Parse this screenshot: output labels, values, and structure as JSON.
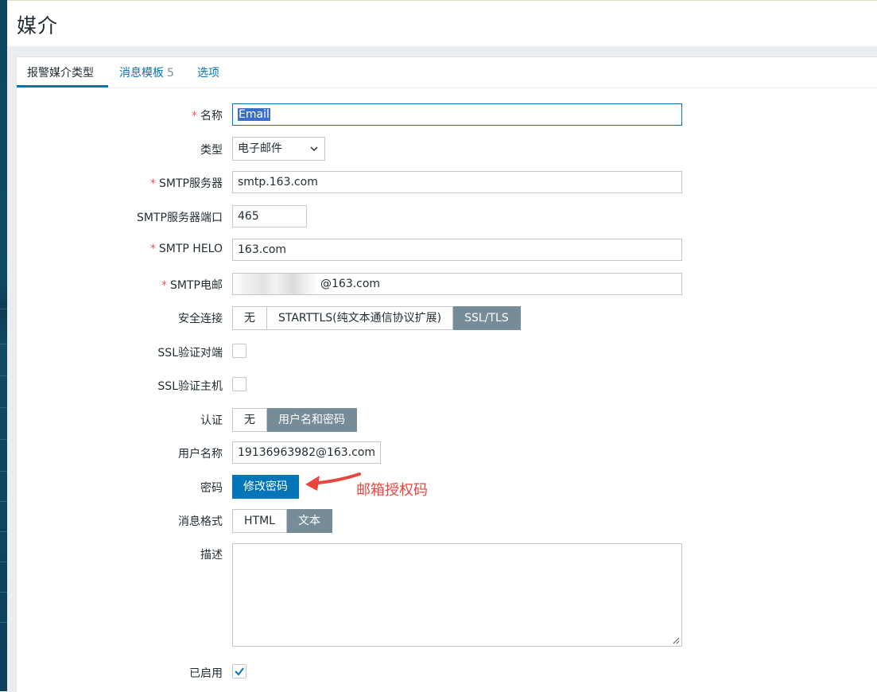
{
  "page": {
    "title": "媒介"
  },
  "tabs": [
    {
      "label": "报警媒介类型",
      "active": true
    },
    {
      "label": "消息模板",
      "count": "5"
    },
    {
      "label": "选项"
    }
  ],
  "form": {
    "name": {
      "label": "名称",
      "value": "Email",
      "required": true
    },
    "type": {
      "label": "类型",
      "value": "电子邮件"
    },
    "smtp_server": {
      "label": "SMTP服务器",
      "value": "smtp.163.com",
      "required": true
    },
    "smtp_port": {
      "label": "SMTP服务器端口",
      "value": "465"
    },
    "smtp_helo": {
      "label": "SMTP HELO",
      "value": "163.com",
      "required": true
    },
    "smtp_email": {
      "label": "SMTP电邮",
      "value": "@163.com",
      "required": true
    },
    "security": {
      "label": "安全连接",
      "options": [
        "无",
        "STARTTLS(纯文本通信协议扩展)",
        "SSL/TLS"
      ],
      "selected": "SSL/TLS"
    },
    "ssl_verify_peer": {
      "label": "SSL验证对端",
      "checked": false
    },
    "ssl_verify_host": {
      "label": "SSL验证主机",
      "checked": false
    },
    "auth": {
      "label": "认证",
      "options": [
        "无",
        "用户名和密码"
      ],
      "selected": "用户名和密码"
    },
    "username": {
      "label": "用户名称",
      "value": "19136963982@163.com"
    },
    "password": {
      "label": "密码",
      "button": "修改密码"
    },
    "message_format": {
      "label": "消息格式",
      "options": [
        "HTML",
        "文本"
      ],
      "selected": "文本"
    },
    "description": {
      "label": "描述",
      "value": ""
    },
    "enabled": {
      "label": "已启用",
      "checked": true
    }
  },
  "annotation": {
    "text": "邮箱授权码",
    "color": "#e8453c"
  },
  "colors": {
    "accent": "#0275b8",
    "segment_active": "#768d99",
    "required": "#e45959",
    "sidebar": "#0e4b66"
  }
}
